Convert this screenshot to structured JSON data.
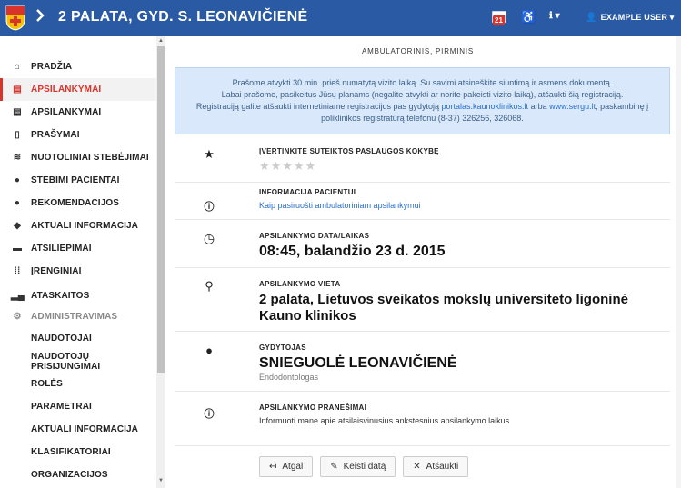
{
  "header": {
    "back_icon": "chevron-right",
    "title": "2 PALATA, GYD. S. LEONAVIČIENĖ",
    "calendar_badge": "21",
    "user_label": "EXAMPLE USER",
    "info_caret": "▾",
    "user_caret": "▾",
    "brand_color": "#2a5aa3"
  },
  "sidebar": {
    "items": [
      {
        "label": "PRADŽIA",
        "icon": "home-icon"
      },
      {
        "label": "APSILANKYMAI",
        "icon": "calendar-icon",
        "active": true
      },
      {
        "label": "APSILANKYMAI",
        "icon": "calendar-list-icon"
      },
      {
        "label": "PRAŠYMAI",
        "icon": "clipboard-icon"
      },
      {
        "label": "NUOTOLINIAI STEBĖJIMAI",
        "icon": "wifi-icon"
      },
      {
        "label": "STEBIMI PACIENTAI",
        "icon": "user-icon"
      },
      {
        "label": "REKOMENDACIJOS",
        "icon": "speech-bubble-icon"
      },
      {
        "label": "AKTUALI INFORMACIJA",
        "icon": "graduation-cap-icon"
      },
      {
        "label": "ATSILIEPIMAI",
        "icon": "comment-icon"
      },
      {
        "label": "ĮRENGINIAI",
        "icon": "grid-icon"
      },
      {
        "label": "ATASKAITOS",
        "icon": "bar-chart-icon"
      },
      {
        "label": "ADMINISTRAVIMAS",
        "icon": "gear-icon",
        "muted": true
      }
    ],
    "sub_items": [
      "NAUDOTOJAI",
      "NAUDOTOJŲ PRISIJUNGIMAI",
      "ROLĖS",
      "PARAMETRAI",
      "AKTUALI INFORMACIJA",
      "KLASIFIKATORIAI",
      "ORGANIZACIJOS"
    ],
    "active_color": "#d9342b"
  },
  "main": {
    "breadcrumb": "AMBULATORINIS, PIRMINIS",
    "notice": {
      "line1": "Prašome atvykti 30 min. prieš numatytą vizito laiką. Su savimi atsineškite siuntimą ir asmens dokumentą.",
      "line2": "Labai prašome, pasikeitus Jūsų planams (negalite atvykti ar norite pakeisti vizito laiką), atšaukti šią registraciją.",
      "line3a": "Registraciją galite atšaukti internetiniame registracijos pas gydytoją ",
      "line3link1": "portalas.kaunoklinikos.lt",
      "line3b": " arba ",
      "line3link2": "www.sergu.lt",
      "line3c": ", paskambinę į",
      "line4": "poliklinikos registratūrą telefonu (8-37) 326256, 326068."
    },
    "rating": {
      "label": "ĮVERTINKITE SUTEIKTOS PASLAUGOS KOKYBĘ",
      "stars": "★★★★★",
      "value": 0,
      "max": 5
    },
    "patient_info": {
      "label": "INFORMACIJA PACIENTUI",
      "link": "Kaip pasiruošti ambulatoriniam apsilankymui"
    },
    "date": {
      "label": "APSILANKYMO DATA/LAIKAS",
      "value": "08:45, balandžio 23 d. 2015"
    },
    "place": {
      "label": "APSILANKYMO VIETA",
      "line1": "2 palata, Lietuvos sveikatos mokslų universiteto ligoninė",
      "line2": "Kauno klinikos"
    },
    "doctor": {
      "label": "GYDYTOJAS",
      "name": "SNIEGUOLĖ LEONAVIČIENĖ",
      "specialty": "Endodontologas"
    },
    "messages": {
      "label": "APSILANKYMO PRANEŠIMAI",
      "text": "Informuoti mane apie atsilaisvinusius ankstesnius apsilankymo laikus"
    },
    "buttons": {
      "back": "Atgal",
      "change_date": "Keisti datą",
      "cancel": "Atšaukti"
    }
  }
}
